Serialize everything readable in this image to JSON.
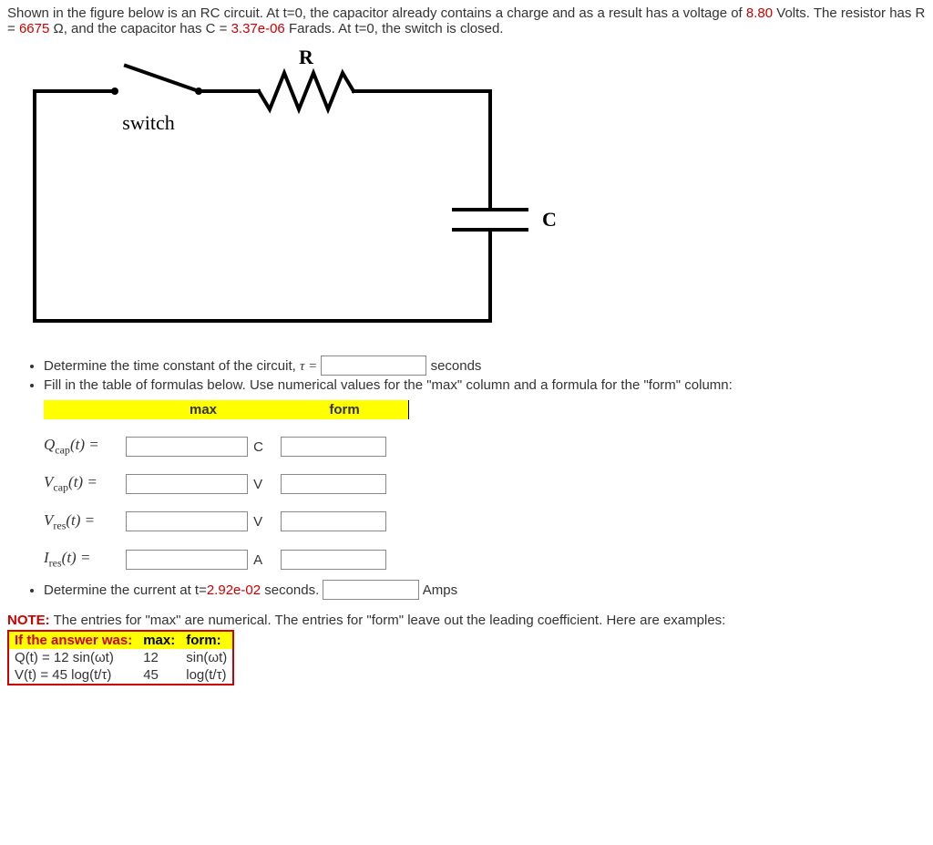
{
  "intro": {
    "pre1": "Shown in the figure below is an RC circuit. At t=0, the capacitor already contains a charge and as a result has a voltage of ",
    "v0": "8.80",
    "mid1": " Volts. The resistor has R = ",
    "R": "6675",
    "mid2": " Ω, and the capacitor has C = ",
    "C": "3.37e-06",
    "post": " Farads. At t=0, the switch is closed."
  },
  "circuit_labels": {
    "R": "R",
    "C": "C",
    "switch": "switch"
  },
  "q_tau": {
    "prefix": "Determine the time constant of the circuit, ",
    "tau_eq": "τ =",
    "suffix": "seconds"
  },
  "q_table_intro": "Fill in the table of formulas below. Use numerical values for the \"max\" column and a formula for the \"form\" column:",
  "headers": {
    "max": "max",
    "form": "form"
  },
  "rows": {
    "Qcap": {
      "sym": "Q",
      "sub": "cap",
      "unit": "C"
    },
    "Vcap": {
      "sym": "V",
      "sub": "cap",
      "unit": "V"
    },
    "Vres": {
      "sym": "V",
      "sub": "res",
      "unit": "V"
    },
    "Ires": {
      "sym": "I",
      "sub": "res",
      "unit": "A"
    }
  },
  "q_current": {
    "prefix": "Determine the current at t=",
    "t": "2.92e-02",
    "mid": " seconds.",
    "suffix": "Amps"
  },
  "note": {
    "label": "NOTE:",
    "text": " The entries for \"max\" are numerical. The entries for \"form\" leave out the leading coefficient. Here are examples:"
  },
  "example": {
    "hdr": {
      "a": "If the answer was:",
      "b": "max:",
      "c": "form:"
    },
    "r1": {
      "lhs": "Q(t) = 12 sin(ωt)",
      "max": "12",
      "form": "sin(ωt)"
    },
    "r2": {
      "lhs": "V(t) = 45 log(t/τ)",
      "max": "45",
      "form": "log(t/τ)"
    }
  }
}
